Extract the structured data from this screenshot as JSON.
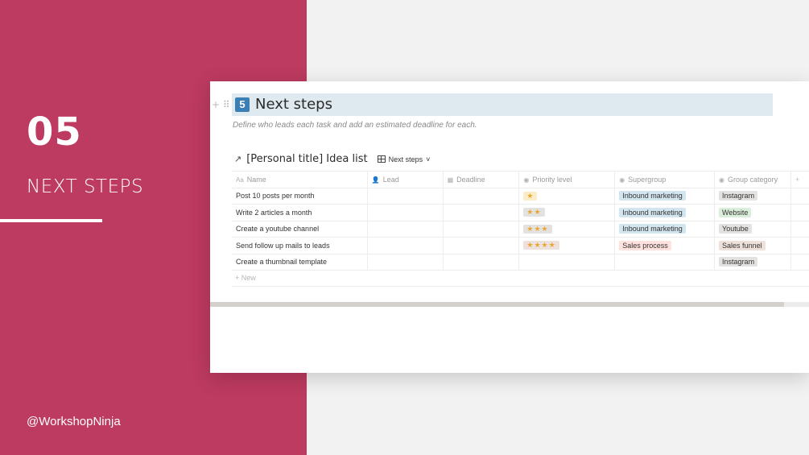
{
  "slide": {
    "number": "05",
    "title": "NEXT STEPS",
    "handle": "@WorkshopNinja",
    "accent_color": "#bd3a60"
  },
  "page": {
    "heading_number": "5",
    "heading": "Next steps",
    "subtitle": "Define who leads each task and add an estimated deadline for each."
  },
  "database": {
    "arrow": "↗",
    "title": "[Personal title] Idea list",
    "view_label": "Next steps",
    "view_chevron": "˅",
    "columns": [
      {
        "label": "Name",
        "icon": "Aa"
      },
      {
        "label": "Lead",
        "icon": "person-icon"
      },
      {
        "label": "Deadline",
        "icon": "calendar-icon"
      },
      {
        "label": "Priority level",
        "icon": "select-icon"
      },
      {
        "label": "Supergroup",
        "icon": "select-icon"
      },
      {
        "label": "Group category",
        "icon": "select-icon"
      }
    ],
    "add_column": "+",
    "rows": [
      {
        "name": "Post 10 posts per month",
        "lead": "",
        "deadline": "",
        "priority": 1,
        "priority_text": "★",
        "supergroup": "Inbound marketing",
        "category": "Instagram"
      },
      {
        "name": "Write 2 articles a month",
        "lead": "",
        "deadline": "",
        "priority": 2,
        "priority_text": "★★",
        "supergroup": "Inbound marketing",
        "category": "Website"
      },
      {
        "name": "Create a youtube channel",
        "lead": "",
        "deadline": "",
        "priority": 3,
        "priority_text": "★★★",
        "supergroup": "Inbound marketing",
        "category": "Youtube"
      },
      {
        "name": "Send follow up mails to leads",
        "lead": "",
        "deadline": "",
        "priority": 4,
        "priority_text": "★★★★",
        "supergroup": "Sales process",
        "category": "Sales funnel"
      },
      {
        "name": "Create a thumbnail template",
        "lead": "",
        "deadline": "",
        "priority": 0,
        "priority_text": "",
        "supergroup": "",
        "category": "Instagram"
      }
    ],
    "new_row_label": "New",
    "tag_colors": {
      "Inbound marketing": "#d3e5ef",
      "Sales process": "#ffe2dd",
      "Instagram": "#e3e2e0",
      "Website": "#dbeddb",
      "Youtube": "#e3e2e0",
      "Sales funnel": "#eee0da",
      "priority": [
        "#fdecc8",
        "#e3e2e0",
        "#e3e2e0",
        "#eee0da"
      ]
    }
  }
}
